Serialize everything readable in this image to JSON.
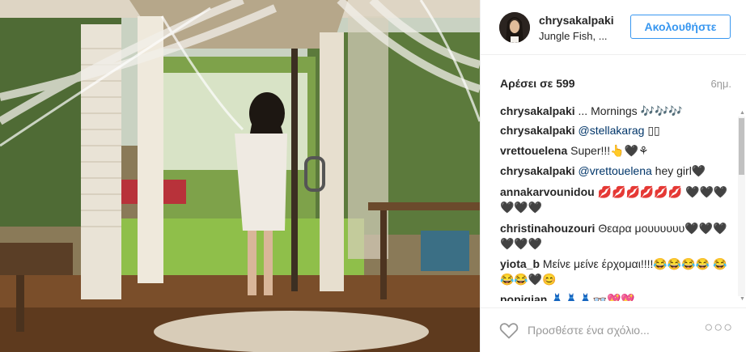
{
  "post": {
    "username": "chrysakalpaki",
    "location": "Jungle Fish, ...",
    "follow_label": "Ακολουθήστε",
    "likes": "Αρέσει σε 599",
    "age": "6ημ."
  },
  "comments": [
    {
      "user": "chrysakalpaki",
      "text": " ... Mornings 🎶🎶🎶"
    },
    {
      "user": "chrysakalpaki",
      "mention": "@stellakarag",
      "text": " ▯▯"
    },
    {
      "user": "vrettouelena",
      "text": " Super!!!👆🖤⚘"
    },
    {
      "user": "chrysakalpaki",
      "mention": "@vrettouelena",
      "text": " hey girl🖤"
    },
    {
      "user": "annakarvounidou",
      "text": " 💋💋💋💋💋💋 🖤🖤🖤🖤🖤🖤"
    },
    {
      "user": "christinahouzouri",
      "text": " Θεαρα μουυυυυυ🖤🖤🖤🖤🖤🖤"
    },
    {
      "user": "yiota_b",
      "text": " Μείνε μείνε έρχομαι!!!!😂😂😂😂 😂😂😂🖤😊"
    },
    {
      "user": "popigian",
      "text": " 👗👗👗👓💖💖"
    }
  ],
  "footer": {
    "comment_placeholder": "Προσθέστε ένα σχόλιο...",
    "more_label": "○○○"
  },
  "icons": {
    "like": "heart-outline-icon",
    "more": "more-options-icon"
  },
  "colors": {
    "accent": "#3897f0",
    "text": "#262626",
    "muted": "#999999",
    "mention": "#003569"
  }
}
